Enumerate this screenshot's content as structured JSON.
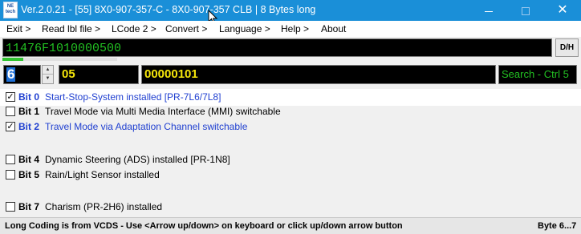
{
  "window": {
    "icon_text": "NE tech",
    "title": "Ver.2.0.21 - [55] 8X0-907-357-C - 8X0-907-357 CLB | 8 Bytes long",
    "minimize_icon": "minimize-icon",
    "maximize_icon": "maximize-icon",
    "close_icon": "close-icon",
    "close_glyph": "✕"
  },
  "menu": [
    {
      "label": "Exit >"
    },
    {
      "label": "Read lbl file >"
    },
    {
      "label": "LCode 2 >"
    },
    {
      "label": "Convert >"
    },
    {
      "label": "Language >"
    },
    {
      "label": "Help >"
    },
    {
      "label": "About"
    }
  ],
  "coding": {
    "long_coding": "11476F1010000500",
    "dh_label": "D/H",
    "progress_fraction": 0.18
  },
  "byte": {
    "number": "6",
    "hex": "05",
    "binary": "00000101",
    "search_label": "Search - Ctrl 5",
    "spin_up": "▲",
    "spin_down": "▼"
  },
  "bits": [
    {
      "label": "Bit 0",
      "desc": "Start-Stop-System installed [PR-7L6/7L8]",
      "checked": true,
      "selected": true
    },
    {
      "label": "Bit 1",
      "desc": "Travel Mode via Multi Media Interface (MMI) switchable",
      "checked": false
    },
    {
      "label": "Bit 2",
      "desc": "Travel Mode via Adaptation Channel switchable",
      "checked": true
    },
    {
      "label": "Bit 4",
      "desc": "Dynamic Steering (ADS) installed [PR-1N8]",
      "checked": false
    },
    {
      "label": "Bit 5",
      "desc": "Rain/Light Sensor installed",
      "checked": false
    },
    {
      "label": "Bit 7",
      "desc": "Charism (PR-2H6) installed",
      "checked": false
    }
  ],
  "status": {
    "text": "Long Coding is from VCDS - Use <Arrow up/down> on keyboard or click up/down arrow button",
    "right": "Byte 6...7"
  },
  "colors": {
    "titlebar": "#1a8fd8",
    "code_text": "#22c022",
    "hex_text": "#f5e60a",
    "checked_text": "#1f3fd0"
  }
}
